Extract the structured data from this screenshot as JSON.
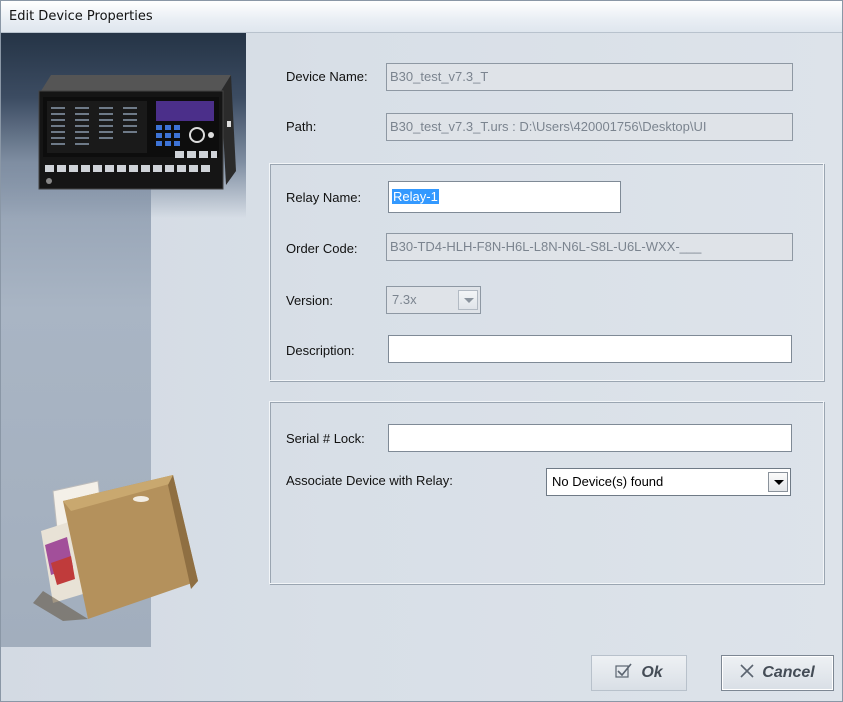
{
  "window": {
    "title": "Edit Device Properties"
  },
  "device": {
    "name_label": "Device Name:",
    "name_value": "B30_test_v7.3_T",
    "path_label": "Path:",
    "path_value": "B30_test_v7.3_T.urs : D:\\Users\\420001756\\Desktop\\UI"
  },
  "relay": {
    "name_label": "Relay Name:",
    "name_value": "Relay-1",
    "order_code_label": "Order Code:",
    "order_code_value": "B30-TD4-HLH-F8N-H6L-L8N-N6L-S8L-U6L-WXX-___",
    "version_label": "Version:",
    "version_value": "7.3x",
    "description_label": "Description:",
    "description_value": ""
  },
  "serial": {
    "lock_label": "Serial # Lock:",
    "lock_value": "",
    "associate_label": "Associate Device with Relay:",
    "associate_value": "No Device(s) found"
  },
  "buttons": {
    "ok_label": "Ok",
    "cancel_label": "Cancel"
  },
  "icons": {
    "ok": "check-icon",
    "cancel": "close-icon"
  }
}
